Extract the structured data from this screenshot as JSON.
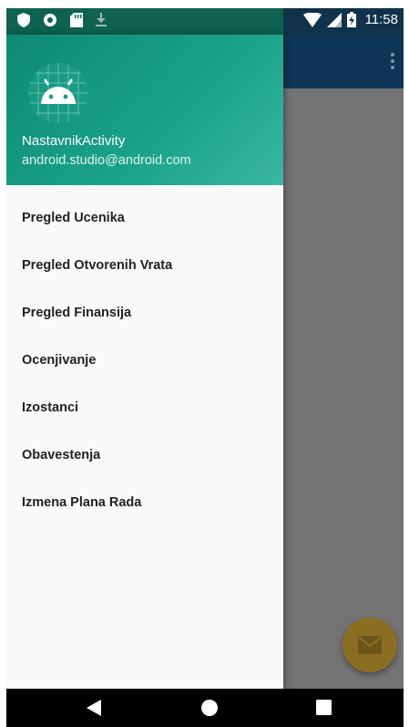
{
  "status_bar": {
    "time": "11:58",
    "icons_left": [
      "shield-icon",
      "circle-icon",
      "sd-card-icon",
      "download-icon"
    ],
    "icons_right": [
      "wifi-icon",
      "signal-icon",
      "battery-icon"
    ]
  },
  "app_bar": {
    "menu_icon": "more-vert-icon"
  },
  "drawer": {
    "header": {
      "title": "NastavnikActivity",
      "subtitle": "android.studio@android.com",
      "logo_icon": "android-logo-icon"
    },
    "items": [
      {
        "label": "Pregled Ucenika"
      },
      {
        "label": "Pregled Otvorenih Vrata"
      },
      {
        "label": "Pregled Finansija"
      },
      {
        "label": "Ocenjivanje"
      },
      {
        "label": "Izostanci"
      },
      {
        "label": "Obavestenja"
      },
      {
        "label": "Izmena Plana Rada"
      }
    ]
  },
  "fab": {
    "icon": "email-icon"
  },
  "nav_bar": {
    "buttons": [
      "back-icon",
      "home-icon",
      "recents-icon"
    ]
  },
  "colors": {
    "header": "#1aa38a",
    "app_bar": "#0e3555",
    "scrim": "#737373",
    "fab": "#8b6e22"
  }
}
